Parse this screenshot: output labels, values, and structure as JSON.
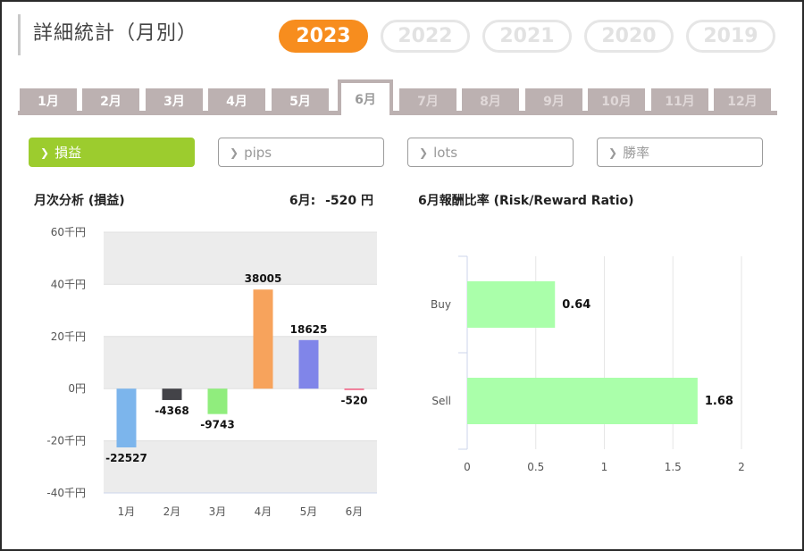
{
  "header": {
    "title": "詳細統計（月別）"
  },
  "years": [
    {
      "label": "2023",
      "active": true
    },
    {
      "label": "2022",
      "active": false
    },
    {
      "label": "2021",
      "active": false
    },
    {
      "label": "2020",
      "active": false
    },
    {
      "label": "2019",
      "active": false
    }
  ],
  "months": [
    "1月",
    "2月",
    "3月",
    "4月",
    "5月",
    "6月",
    "7月",
    "8月",
    "9月",
    "10月",
    "11月",
    "12月"
  ],
  "active_month_index": 5,
  "filters": [
    {
      "label": "損益",
      "active": true
    },
    {
      "label": "pips",
      "active": false
    },
    {
      "label": "lots",
      "active": false
    },
    {
      "label": "勝率",
      "active": false
    }
  ],
  "left_panel": {
    "title": "月次分析 (損益)",
    "summary_label": "6月:",
    "summary_value": "-520 円"
  },
  "right_panel": {
    "title": "6月報酬比率 (Risk/Reward Ratio)"
  },
  "colors": {
    "active_year": "#f78d1e",
    "active_filter": "#9ccc2e",
    "tab_bg": "#bcb1b1",
    "ratio_bar": "#aaffaa"
  },
  "chart_data": [
    {
      "type": "bar",
      "categories": [
        "1月",
        "2月",
        "3月",
        "4月",
        "5月",
        "6月"
      ],
      "values": [
        -22527,
        -4368,
        -9743,
        38005,
        18625,
        -520
      ],
      "data_labels": [
        "-22527",
        "-4368",
        "-9743",
        "38005",
        "18625",
        "-520"
      ],
      "bar_colors": [
        "#7cb5ec",
        "#434348",
        "#90ed7d",
        "#f7a35c",
        "#8085e9",
        "#f15c80"
      ],
      "yticks": [
        "60千円",
        "40千円",
        "20千円",
        "0円",
        "-20千円",
        "-40千円"
      ],
      "ytick_values": [
        60000,
        40000,
        20000,
        0,
        -20000,
        -40000
      ],
      "ylim": [
        -40000,
        60000
      ],
      "grid": "alternating-bands"
    },
    {
      "type": "bar",
      "orientation": "horizontal",
      "categories": [
        "Buy",
        "Sell"
      ],
      "values": [
        0.64,
        1.68
      ],
      "data_labels": [
        "0.64",
        "1.68"
      ],
      "xticks": [
        "0",
        "0.5",
        "1",
        "1.5",
        "2"
      ],
      "xtick_values": [
        0,
        0.5,
        1,
        1.5,
        2
      ],
      "xlim": [
        0,
        2
      ],
      "grid": true
    }
  ]
}
